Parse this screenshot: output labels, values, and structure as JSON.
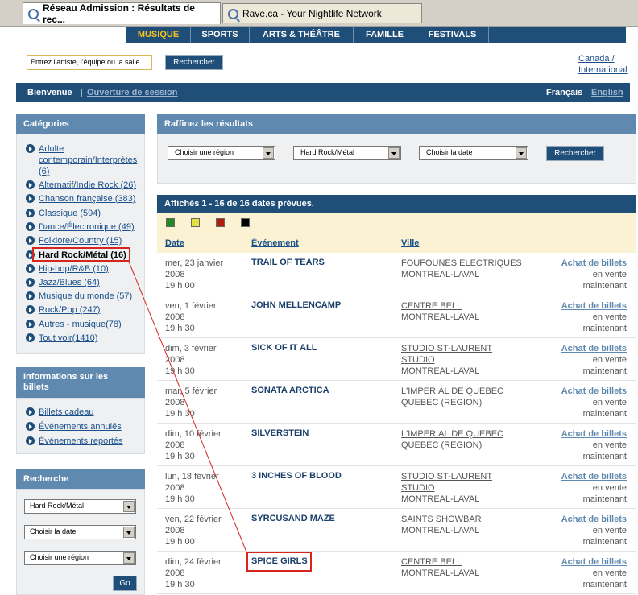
{
  "browser": {
    "tabs": [
      {
        "title": "Réseau Admission : Résultats de rec...",
        "active": true
      },
      {
        "title": "Rave.ca - Your Nightlife Network",
        "active": false
      }
    ]
  },
  "topnav": {
    "items": [
      "MUSIQUE",
      "SPORTS",
      "ARTS & THÉÂTRE",
      "FAMILLE",
      "FESTIVALS"
    ],
    "active": "MUSIQUE"
  },
  "search": {
    "placeholder": "Entrez l'artiste, l'équipe ou la salle",
    "button": "Rechercher",
    "region_line1": "Canada /",
    "region_line2": "International"
  },
  "welcome": {
    "greeting": "Bienvenue",
    "separator": "|",
    "login": "Ouverture de session",
    "lang_fr": "Français",
    "lang_en": "English"
  },
  "categories": {
    "title": "Catégories",
    "items": [
      {
        "label": "Adulte contemporain/Interprètes (6)",
        "lines": [
          "Adulte",
          "contemporain/Interprètes",
          "(6)"
        ]
      },
      {
        "label": "Alternatif/Indie Rock (26)"
      },
      {
        "label": "Chanson française (383)"
      },
      {
        "label": "Classique (594)"
      },
      {
        "label": "Dance/Électronique (49)"
      },
      {
        "label": "Folklore/Country (15)"
      },
      {
        "label": "Hard Rock/Métal (16)",
        "selected": true
      },
      {
        "label": "Hip-hop/R&B (10)"
      },
      {
        "label": "Jazz/Blues (64)"
      },
      {
        "label": "Musique du monde (57)"
      },
      {
        "label": "Rock/Pop (247)"
      },
      {
        "label": "Autres - musique(78)"
      },
      {
        "label": "Tout voir(1410)"
      }
    ]
  },
  "ticket_info": {
    "title_line1": "Informations sur les",
    "title_line2": "billets",
    "items": [
      "Billets cadeau",
      "Événements annulés",
      "Événements reportés"
    ]
  },
  "side_search": {
    "title": "Recherche",
    "genre": "Hard Rock/Métal",
    "date": "Choisir la date",
    "region": "Choisir une région",
    "go": "Go"
  },
  "refine": {
    "title": "Raffinez les résultats",
    "region": "Choisir une région",
    "genre": "Hard Rock/Métal",
    "date": "Choisir la date",
    "button": "Rechercher"
  },
  "results": {
    "summary": "Affichés 1 - 16 de 16 dates prévues.",
    "legend_colors": [
      "#1f8a1f",
      "#e6e046",
      "#b01c10",
      "#000000"
    ],
    "columns": {
      "date": "Date",
      "event": "Événement",
      "city": "Ville"
    },
    "rows": [
      {
        "date1": "mer, 23 janvier",
        "date2": "2008",
        "time": "19 h 00",
        "event": "TRAIL OF TEARS",
        "venue1": "FOUFOUNES ELECTRIQUES",
        "venue2": "",
        "city": "MONTREAL-LAVAL",
        "ticket": "Achat de billets",
        "status1": "en vente",
        "status2": "maintenant"
      },
      {
        "date1": "ven, 1 février",
        "date2": "2008",
        "time": "19 h 30",
        "event": "JOHN MELLENCAMP",
        "venue1": "CENTRE BELL",
        "venue2": "",
        "city": "MONTREAL-LAVAL",
        "ticket": "Achat de billets",
        "status1": "en vente",
        "status2": "maintenant"
      },
      {
        "date1": "dim, 3 février",
        "date2": "2008",
        "time": "19 h 30",
        "event": "SICK OF IT ALL",
        "venue1": "STUDIO ST-LAURENT",
        "venue2": "STUDIO",
        "city": "MONTREAL-LAVAL",
        "ticket": "Achat de billets",
        "status1": "en vente",
        "status2": "maintenant"
      },
      {
        "date1": "mar, 5 février",
        "date2": "2008",
        "time": "19 h 30",
        "event": "SONATA ARCTICA",
        "venue1": "L'IMPERIAL DE QUEBEC",
        "venue2": "",
        "city": "QUEBEC (REGION)",
        "ticket": "Achat de billets",
        "status1": "en vente",
        "status2": "maintenant"
      },
      {
        "date1": "dim, 10 février",
        "date2": "2008",
        "time": "19 h 30",
        "event": "SILVERSTEIN",
        "venue1": "L'IMPERIAL DE QUEBEC",
        "venue2": "",
        "city": "QUEBEC (REGION)",
        "ticket": "Achat de billets",
        "status1": "en vente",
        "status2": "maintenant"
      },
      {
        "date1": "lun, 18 février",
        "date2": "2008",
        "time": "19 h 30",
        "event": "3 INCHES OF BLOOD",
        "venue1": "STUDIO ST-LAURENT",
        "venue2": "STUDIO",
        "city": "MONTREAL-LAVAL",
        "ticket": "Achat de billets",
        "status1": "en vente",
        "status2": "maintenant"
      },
      {
        "date1": "ven, 22 février",
        "date2": "2008",
        "time": "19 h 00",
        "event": "SYRCUSAND MAZE",
        "venue1": "SAINTS SHOWBAR",
        "venue2": "",
        "city": "MONTREAL-LAVAL",
        "ticket": "Achat de billets",
        "status1": "en vente",
        "status2": "maintenant"
      },
      {
        "date1": "dim, 24 février",
        "date2": "2008",
        "time": "19 h 30",
        "event": "SPICE GIRLS",
        "venue1": "CENTRE BELL",
        "venue2": "",
        "city": "MONTREAL-LAVAL",
        "ticket": "Achat de billets",
        "status1": "en vente",
        "status2": "maintenant",
        "highlighted": true
      }
    ]
  },
  "annotation_color": "#d6261c"
}
